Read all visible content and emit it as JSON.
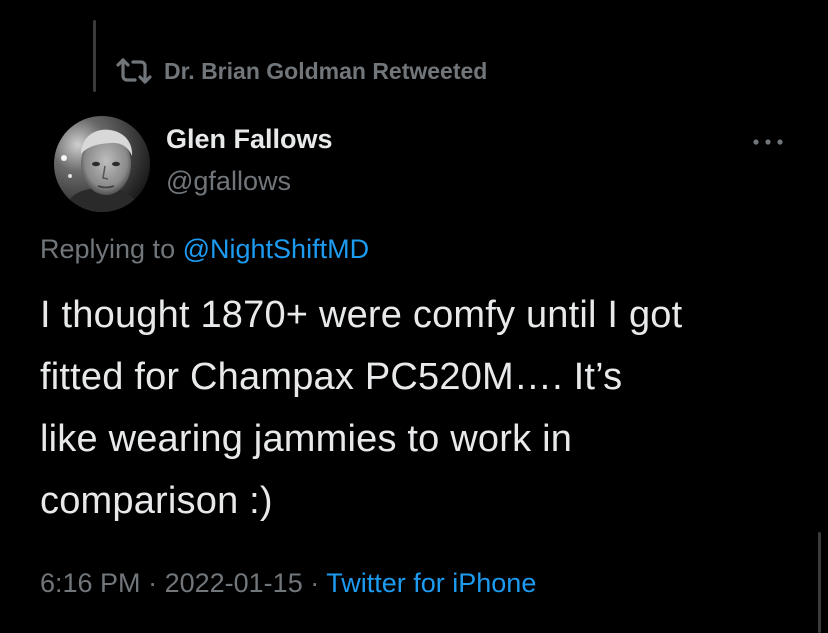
{
  "retweet": {
    "icon": "retweet-icon",
    "text": "Dr. Brian Goldman Retweeted"
  },
  "author": {
    "display_name": "Glen Fallows",
    "handle": "@gfallows",
    "avatar": "avatar"
  },
  "more_icon": "more-horizontal-icon",
  "reply": {
    "label": "Replying to",
    "handle": "@NightShiftMD"
  },
  "tweet": {
    "text": "I thought 1870+ were comfy until I got\nfitted for Champax PC520M…. It’s\nlike wearing jammies to work in\ncomparison :)"
  },
  "meta": {
    "time": "6:16 PM",
    "separator": "·",
    "date": "2022-01-15",
    "source": "Twitter for iPhone"
  },
  "colors": {
    "background": "#000000",
    "primary_text": "#e7e9ea",
    "secondary_text": "#71767b",
    "accent": "#1d9bf0"
  }
}
